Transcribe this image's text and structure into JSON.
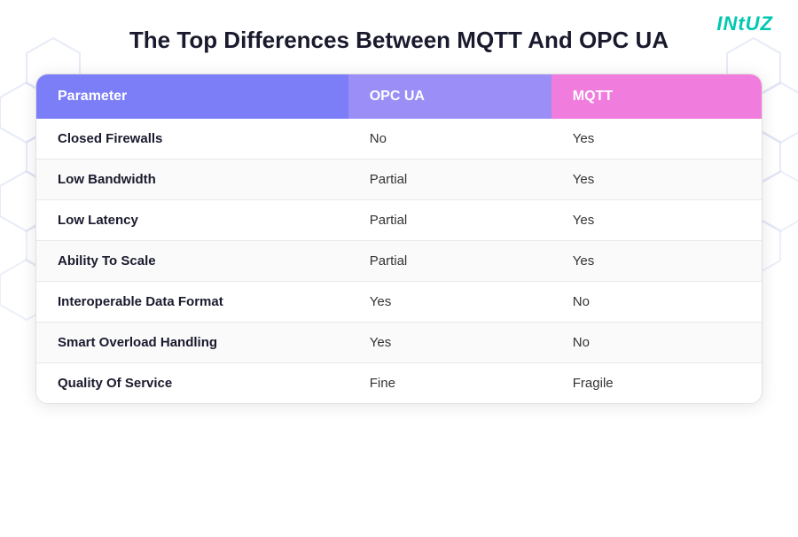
{
  "logo": {
    "text": "INtUZ"
  },
  "title": "The Top Differences Between MQTT And OPC UA",
  "table": {
    "headers": [
      {
        "key": "parameter",
        "label": "Parameter"
      },
      {
        "key": "opcua",
        "label": "OPC UA"
      },
      {
        "key": "mqtt",
        "label": "MQTT"
      }
    ],
    "rows": [
      {
        "parameter": "Closed Firewalls",
        "opcua": "No",
        "mqtt": "Yes"
      },
      {
        "parameter": "Low Bandwidth",
        "opcua": "Partial",
        "mqtt": "Yes"
      },
      {
        "parameter": "Low Latency",
        "opcua": "Partial",
        "mqtt": "Yes"
      },
      {
        "parameter": "Ability To Scale",
        "opcua": "Partial",
        "mqtt": "Yes"
      },
      {
        "parameter": "Interoperable Data Format",
        "opcua": "Yes",
        "mqtt": "No"
      },
      {
        "parameter": "Smart Overload Handling",
        "opcua": "Yes",
        "mqtt": "No"
      },
      {
        "parameter": "Quality Of Service",
        "opcua": "Fine",
        "mqtt": "Fragile"
      }
    ]
  }
}
